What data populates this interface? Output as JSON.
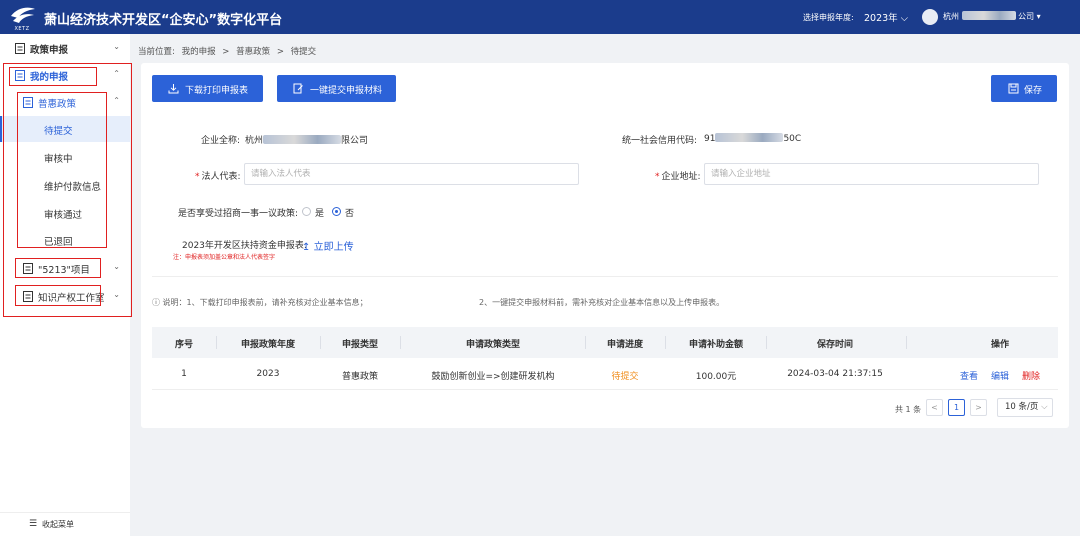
{
  "header": {
    "logo_text": "XETZ",
    "title": "萧山经济技术开发区“企安心”数字化平台",
    "year_label": "选择申报年度:",
    "year_value": "2023年",
    "user_prefix": "杭州",
    "user_suffix": "公司"
  },
  "sidebar": {
    "items": [
      {
        "label": "政策申报"
      },
      {
        "label": "我的申报"
      },
      {
        "label": "普惠政策"
      },
      {
        "label": "待提交"
      },
      {
        "label": "审核中"
      },
      {
        "label": "维护付款信息"
      },
      {
        "label": "审核通过"
      },
      {
        "label": "已退回"
      },
      {
        "label": "\"5213\"项目"
      },
      {
        "label": "知识产权工作室"
      }
    ],
    "collapse_label": "收起菜单"
  },
  "breadcrumb": {
    "prefix": "当前位置:",
    "items": [
      "我的申报",
      "普惠政策",
      "待提交"
    ],
    "separator": ">"
  },
  "toolbar": {
    "download_label": "下载打印申报表",
    "submit_label": "一键提交申报材料",
    "save_label": "保存"
  },
  "form": {
    "company_label": "企业全称:",
    "company_prefix": "杭州",
    "company_suffix": "限公司",
    "credit_label": "统一社会信用代码:",
    "credit_prefix": "91",
    "credit_suffix": "50C",
    "legal_label": "法人代表:",
    "legal_placeholder": "请输入法人代表",
    "address_label": "企业地址:",
    "address_placeholder": "请输入企业地址",
    "policy_question": "是否享受过招商一事一议政策:",
    "option_yes": "是",
    "option_no": "否",
    "upload_label": "2023年开发区扶持资金申报表:",
    "upload_link": "立即上传",
    "note": "注：申报表须加盖公章和法人代表签字"
  },
  "info": {
    "prefix": "说明：",
    "line1": "1、下载打印申报表前，请补充核对企业基本信息；",
    "line2": "2、一键提交申报材料前，需补充核对企业基本信息以及上传申报表。"
  },
  "table": {
    "headers": [
      "序号",
      "申报政策年度",
      "申报类型",
      "申请政策类型",
      "申请进度",
      "申请补助金额",
      "保存时间",
      "操作"
    ],
    "rows": [
      [
        "1",
        "2023",
        "普惠政策",
        "鼓励创新创业=>创建研发机构",
        "待提交",
        "100.00元",
        "2024-03-04 21:37:15"
      ]
    ],
    "actions": [
      "查看",
      "编辑",
      "删除"
    ]
  },
  "pagination": {
    "total": "共 1 条",
    "prev": "<",
    "page": "1",
    "next": ">",
    "page_size": "10 条/页"
  },
  "colors": {
    "header_bg": "#1b3c8c",
    "primary": "#2c62d8",
    "highlight_box": "#e02020",
    "status_pending": "#f08c1a",
    "delete_red": "#e02020"
  }
}
